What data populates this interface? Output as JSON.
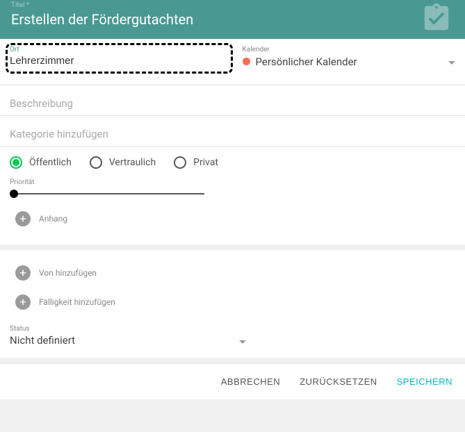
{
  "header": {
    "label": "Titel *",
    "title": "Erstellen der Fördergutachten"
  },
  "ort": {
    "label": "Ort",
    "value": "Lehrerzimmer"
  },
  "kalender": {
    "label": "Kalender",
    "value": "Persönlicher Kalender"
  },
  "beschreibung": {
    "placeholder": "Beschreibung"
  },
  "kategorie": {
    "placeholder": "Kategorie hinzufügen"
  },
  "visibility": {
    "options": {
      "public": "Öffentlich",
      "confidential": "Vertraulich",
      "private": "Privat"
    }
  },
  "prioritaet": {
    "label": "Priorität"
  },
  "anhang": {
    "label": "Anhang"
  },
  "von": {
    "label": "Von hinzufügen"
  },
  "faelligkeit": {
    "label": "Fälligkeit hinzufügen"
  },
  "status": {
    "label": "Status",
    "value": "Nicht definiert"
  },
  "buttons": {
    "cancel": "ABBRECHEN",
    "reset": "ZURÜCKSETZEN",
    "save": "SPEICHERN"
  }
}
